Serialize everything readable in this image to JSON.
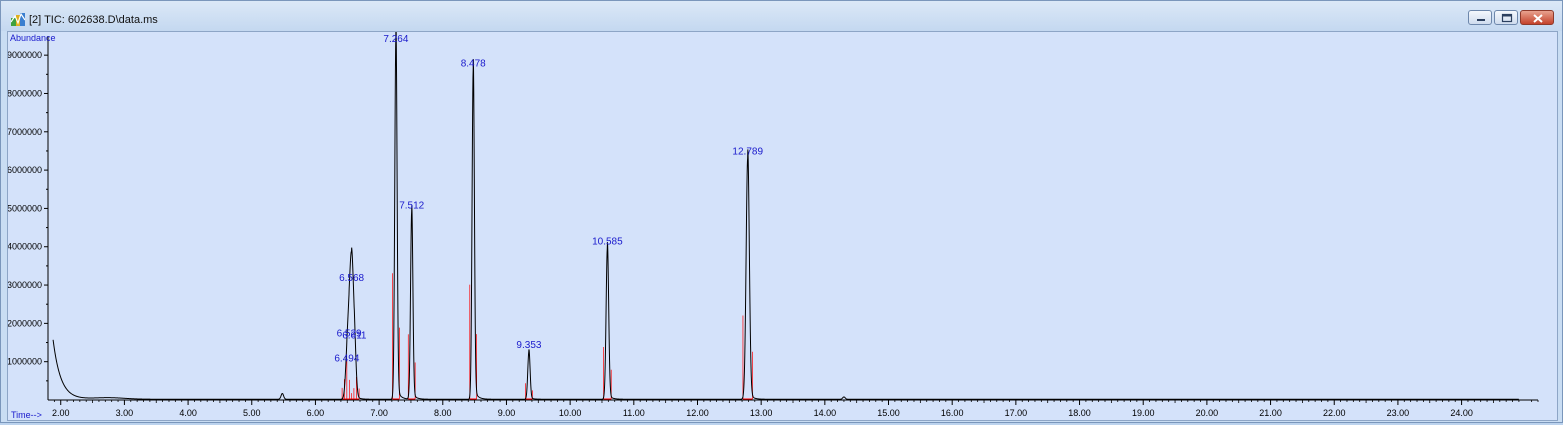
{
  "window": {
    "title": "[2] TIC: 602638.D\\data.ms",
    "icon": "chromatogram-app-icon",
    "buttons": [
      "minimize-icon",
      "maximize-icon",
      "close-icon"
    ]
  },
  "colors": {
    "trace": "#000000",
    "integration": "#ff0000",
    "peak_label": "#1a1acc",
    "axis_label": "#1a1acc",
    "plot_bg": "#d4e2fa"
  },
  "chart_data": {
    "type": "line",
    "ylabel": "Abundance",
    "xlabel": "Time-->",
    "xlim": [
      1.8,
      25.2
    ],
    "ylim": [
      0,
      9500000
    ],
    "y_ticks": [
      1000000,
      2000000,
      3000000,
      4000000,
      5000000,
      6000000,
      7000000,
      8000000,
      9000000
    ],
    "y_tick_labels": [
      "1000000",
      "2000000",
      "3000000",
      "4000000",
      "5000000",
      "6000000",
      "7000000",
      "8000000",
      "9000000"
    ],
    "x_ticks": [
      2,
      3,
      4,
      5,
      6,
      7,
      8,
      9,
      10,
      11,
      12,
      13,
      14,
      15,
      16,
      17,
      18,
      19,
      20,
      21,
      22,
      23,
      24
    ],
    "x_tick_labels": [
      "2.00",
      "3.00",
      "4.00",
      "5.00",
      "6.00",
      "7.00",
      "8.00",
      "9.00",
      "10.00",
      "11.00",
      "12.00",
      "13.00",
      "14.00",
      "15.00",
      "16.00",
      "17.00",
      "18.00",
      "19.00",
      "20.00",
      "21.00",
      "22.00",
      "23.00",
      "24.00"
    ],
    "grid": false,
    "peaks": [
      {
        "rt": 6.494,
        "label": "6.494",
        "height": 900000,
        "width": 0.025
      },
      {
        "rt": 6.529,
        "label": "6.529",
        "height": 1550000,
        "width": 0.025
      },
      {
        "rt": 6.568,
        "label": "6.568",
        "height": 3000000,
        "width": 0.025
      },
      {
        "rt": 6.611,
        "label": "6.611",
        "height": 1500000,
        "width": 0.025
      },
      {
        "rt": 7.264,
        "label": "7.264",
        "height": 9450000,
        "width": 0.018
      },
      {
        "rt": 7.512,
        "label": "7.512",
        "height": 4900000,
        "width": 0.018
      },
      {
        "rt": 8.478,
        "label": "8.478",
        "height": 8600000,
        "width": 0.018
      },
      {
        "rt": 9.353,
        "label": "9.353",
        "height": 1250000,
        "width": 0.018
      },
      {
        "rt": 10.585,
        "label": "10.585",
        "height": 3950000,
        "width": 0.02
      },
      {
        "rt": 12.789,
        "label": "12.789",
        "height": 6300000,
        "width": 0.025
      }
    ],
    "minor_features": [
      {
        "rt": 1.88,
        "height": 1550000,
        "decay": 0.12
      },
      {
        "rt": 5.48,
        "height": 150000,
        "width": 0.02
      },
      {
        "rt": 2.75,
        "height": 40000,
        "width": 0.25
      },
      {
        "rt": 14.3,
        "height": 60000,
        "width": 0.02
      }
    ]
  }
}
